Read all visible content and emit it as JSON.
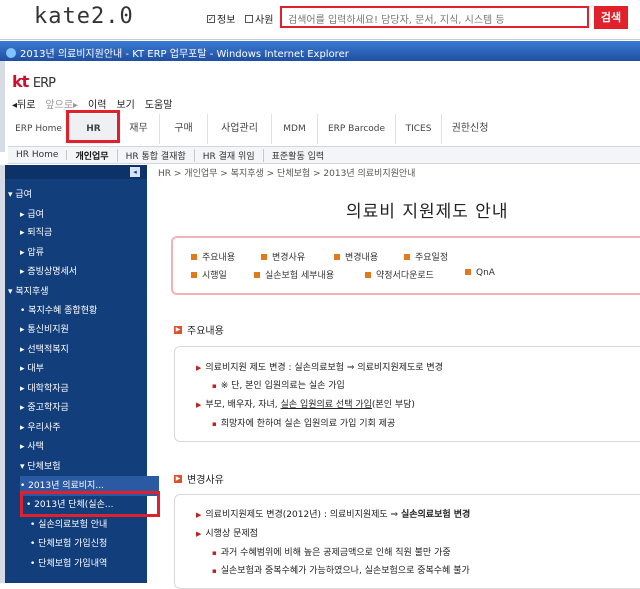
{
  "kate": {
    "logo": "kate2.0",
    "check_info": "정보",
    "check_employee": "사원",
    "search_placeholder": "검색어를 입력하세요! 담당자, 문서, 지식, 시스템 등",
    "search_button": "검색"
  },
  "window": {
    "title": "2013년 의료비지원안내 - KT ERP 업무포탈 - Windows Internet Explorer"
  },
  "app": {
    "logo_kt": "kt",
    "logo_erp": "ERP"
  },
  "menubar": [
    "◂뒤로",
    "앞으로▸",
    "이력",
    "보기",
    "도움말"
  ],
  "tabs": [
    "ERP Home",
    "HR",
    "재무",
    "구매",
    "사업관리",
    "MDM",
    "ERP Barcode",
    "TICES",
    "권한신청"
  ],
  "subnav": [
    "HR Home",
    "개인업무",
    "HR 통합 결재함",
    "HR 결재 위임",
    "표준활동 입력"
  ],
  "sidebar": [
    "▾ 급여",
    "▸ 급여",
    "▸ 퇴직금",
    "▸ 압류",
    "▸ 증빙상명세서",
    "▾ 복지후생",
    "• 복지수혜 종합현황",
    "▸ 통신비지원",
    "▸ 선택적복지",
    "▸ 대부",
    "▸ 대학학자금",
    "▸ 중고학자금",
    "▸ 우리사주",
    "▸ 사택",
    "▾ 단체보험",
    "• 2013년 의료비지...",
    "• 2013년 단체(실손...",
    "• 실손의료보험 안내",
    "• 단체보험 가입신청",
    "• 단체보험 가입내역"
  ],
  "breadcrumb": "HR > 개인업무 > 복지후생 > 단체보험 > 2013년 의료비지원안내",
  "page_title": "의료비 지원제도 안내",
  "summary_links": {
    "row1": [
      "주요내용",
      "변경사유",
      "변경내용",
      "주요일정"
    ],
    "row2": [
      "시행일",
      "실손보험 세부내용",
      "약정서다운로드",
      "QnA"
    ]
  },
  "section1": {
    "heading": "주요내용",
    "line1": "의료비지원 제도 변경 : 실손의료보험 ⇒ 의료비지원제도로 변경",
    "line2": "※ 단, 본인 입원의료는 실손 가입",
    "line3a": "부모, 배우자, 자녀, ",
    "line3b": "실손 입원의료 선택 가입",
    "line3c": "(본인 부담)",
    "line4": "희망자에 한하여 실손 입원의료 가입 기회 제공"
  },
  "section2": {
    "heading": "변경사유",
    "line1a": "의료비지원제도 변경(2012년) : 의료비지원제도 ⇒ ",
    "line1b": "실손의료보험 변경",
    "line2": "시행상 문제점",
    "line3": "과거 수혜범위에 비해 높은 공제금액으로 인해 직원 불만 가중",
    "line4": "실손보험과 중복수혜가 가능하였으나, 실손보험으로 중복수혜 불가"
  },
  "colors": {
    "accent_red": "#e0202a",
    "sidebar_blue": "#123f7c"
  }
}
